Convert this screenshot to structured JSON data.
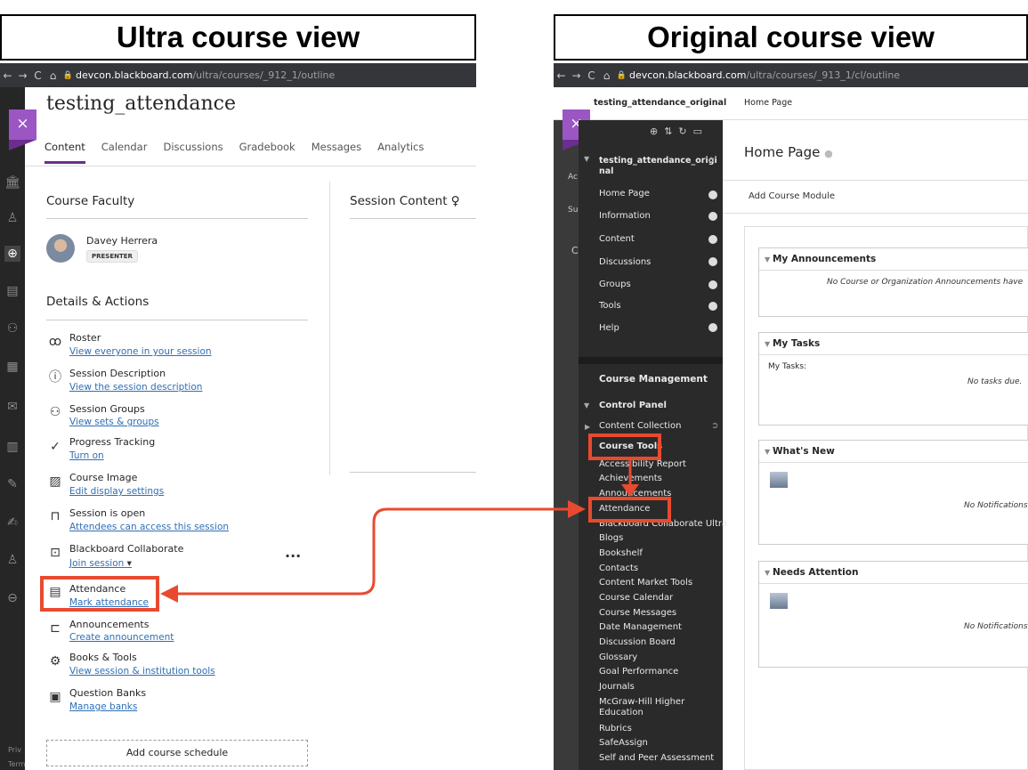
{
  "titles": {
    "ultra": "Ultra course view",
    "original": "Original course view"
  },
  "browser": {
    "ultra_url": {
      "host": "devcon.blackboard.com",
      "path": "/ultra/courses/_912_1/outline"
    },
    "original_url": {
      "host": "devcon.blackboard.com",
      "path": "/ultra/courses/_913_1/cl/outline"
    }
  },
  "ultra": {
    "course_title": "testing_attendance",
    "tabs": [
      "Content",
      "Calendar",
      "Discussions",
      "Gradebook",
      "Messages",
      "Analytics"
    ],
    "faculty_heading": "Course Faculty",
    "faculty_name": "Davey Herrera",
    "faculty_role": "PRESENTER",
    "session_content": "Session Content",
    "details_heading": "Details & Actions",
    "actions": [
      {
        "title": "Roster",
        "link": "View everyone in your session",
        "icon": "roster-icon"
      },
      {
        "title": "Session Description",
        "link": "View the session description",
        "icon": "info-icon"
      },
      {
        "title": "Session Groups",
        "link": "View sets & groups",
        "icon": "groups-icon"
      },
      {
        "title": "Progress Tracking",
        "link": "Turn on",
        "icon": "check-circle-icon"
      },
      {
        "title": "Course Image",
        "link": "Edit display settings",
        "icon": "image-icon"
      },
      {
        "title": "Session is open",
        "link": "Attendees can access this session",
        "icon": "unlock-icon"
      },
      {
        "title": "Blackboard Collaborate",
        "link": "Join session",
        "icon": "collaborate-icon"
      },
      {
        "title": "Attendance",
        "link": "Mark attendance",
        "icon": "attendance-icon"
      },
      {
        "title": "Announcements",
        "link": "Create announcement",
        "icon": "megaphone-icon"
      },
      {
        "title": "Books & Tools",
        "link": "View session & institution tools",
        "icon": "tools-icon"
      },
      {
        "title": "Question Banks",
        "link": "Manage banks",
        "icon": "bank-icon"
      }
    ],
    "add_schedule": "Add course schedule",
    "rail_text": [
      "Priv",
      "Term"
    ]
  },
  "original": {
    "course_name": "testing_attendance_original",
    "breadcrumb": "Home Page",
    "menu_title_1": "testing_attendance_origi",
    "menu_title_2": "nal",
    "menu": [
      "Home Page",
      "Information",
      "Content",
      "Discussions",
      "Groups",
      "Tools",
      "Help"
    ],
    "course_management": "Course Management",
    "control_panel": "Control Panel",
    "content_collection": "Content Collection",
    "course_tools": "Course Tools",
    "tools": [
      "Accessibility Report",
      "Achievements",
      "Announcements",
      "Attendance",
      "Blackboard Collaborate Ultra",
      "Blogs",
      "Bookshelf",
      "Contacts",
      "Content Market Tools",
      "Course Calendar",
      "Course Messages",
      "Date Management",
      "Discussion Board",
      "Glossary",
      "Goal Performance",
      "Journals",
      "McGraw-Hill Higher Education",
      "Rubrics",
      "SafeAssign",
      "Self and Peer Assessment"
    ],
    "page_title": "Home Page",
    "add_module": "Add Course Module",
    "modules": {
      "announcements": {
        "title": "My Announcements",
        "body": "No Course or Organization Announcements have"
      },
      "tasks": {
        "title": "My Tasks",
        "label": "My Tasks:",
        "body": "No tasks due."
      },
      "whats_new": {
        "title": "What's New",
        "body": "No Notifications"
      },
      "needs_attention": {
        "title": "Needs Attention",
        "body": "No Notifications"
      }
    },
    "gutter_letters": [
      "Ac",
      "Su",
      "C"
    ]
  },
  "colors": {
    "highlight": "#e84a30",
    "purple": "#9b56c4",
    "link": "#2f6fb5"
  }
}
